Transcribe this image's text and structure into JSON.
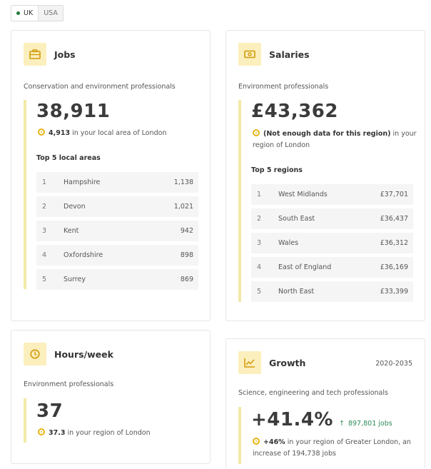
{
  "toggle": {
    "uk": "UK",
    "usa": "USA"
  },
  "jobs": {
    "title": "Jobs",
    "subtitle": "Conservation and environment professionals",
    "value": "38,911",
    "local_count": "4,913",
    "local_text": " in your local area of London",
    "top_title": "Top 5 local areas",
    "rows": [
      {
        "rank": "1",
        "name": "Hampshire",
        "value": "1,138"
      },
      {
        "rank": "2",
        "name": "Devon",
        "value": "1,021"
      },
      {
        "rank": "3",
        "name": "Kent",
        "value": "942"
      },
      {
        "rank": "4",
        "name": "Oxfordshire",
        "value": "898"
      },
      {
        "rank": "5",
        "name": "Surrey",
        "value": "869"
      }
    ]
  },
  "salaries": {
    "title": "Salaries",
    "subtitle": "Environment professionals",
    "value": "£43,362",
    "local_bold": "(Not enough data for this region)",
    "local_text": " in your region of London",
    "top_title": "Top 5 regions",
    "rows": [
      {
        "rank": "1",
        "name": "West Midlands",
        "value": "£37,701"
      },
      {
        "rank": "2",
        "name": "South East",
        "value": "£36,437"
      },
      {
        "rank": "3",
        "name": "Wales",
        "value": "£36,312"
      },
      {
        "rank": "4",
        "name": "East of England",
        "value": "£36,169"
      },
      {
        "rank": "5",
        "name": "North East",
        "value": "£33,399"
      }
    ]
  },
  "hours": {
    "title": "Hours/week",
    "subtitle": "Environment professionals",
    "value": "37",
    "local_bold": "37.3",
    "local_text": " in your region of London"
  },
  "growth": {
    "title": "Growth",
    "range": "2020-2035",
    "subtitle": "Science, engineering and tech professionals",
    "value": "+41.4%",
    "trend_arrow": "↑",
    "trend_text": "897,801 jobs",
    "local_bold": "+46%",
    "local_text": " in your region of Greater London, an increase of 194,738 jobs"
  },
  "colors": {
    "accent": "#f2e9a8",
    "icon_bg": "#fbefbd",
    "pin": "#e6b415",
    "trend": "#2e8b57"
  }
}
